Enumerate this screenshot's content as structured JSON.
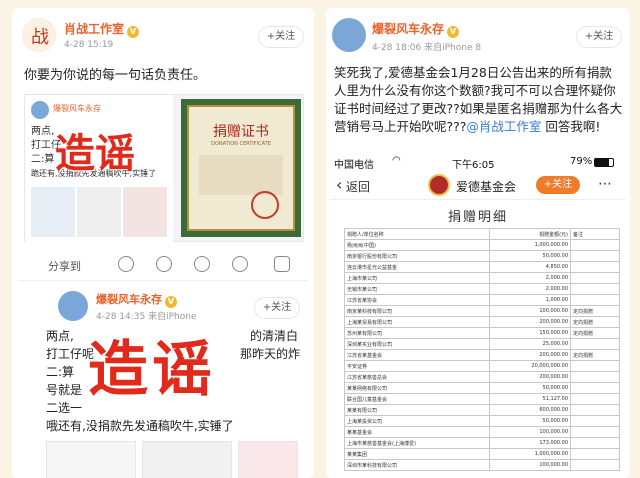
{
  "left_post": {
    "author": "肖战工作室",
    "time": "4-28 15:19",
    "follow_label": "+关注",
    "text": "你要为你说的每一句话负责任。",
    "embedded_screenshot": {
      "author": "爆裂风车永存",
      "stamp": "造谣",
      "certificate_title": "捐赠证书",
      "certificate_subtitle": "DONATION CERTIFICATE",
      "text_lines": [
        "两点,",
        "打工仔",
        "二:算",
        "跪还有,没捐款先发通稿吹牛,实锤了"
      ]
    },
    "actions": {
      "share": "分享到"
    }
  },
  "left_repost": {
    "author": "爆裂风车永存",
    "time": "4-28 14:35",
    "source": "来自iPhone",
    "follow_label": "+关注",
    "stamp": "造谣",
    "text_lines": [
      "两点,",
      "打工仔呢",
      "二:算",
      "号就是",
      "二选一",
      "哦还有,没捐款先发通稿吹牛,实锤了"
    ],
    "text_right": [
      "的清清白",
      "那昨天的炸"
    ]
  },
  "right_post": {
    "author": "爆裂风车永存",
    "time": "4-28 18:06",
    "source": "来自iPhone 8",
    "follow_label": "+关注",
    "text": "笑死我了,爱德基金会1月28日公告出来的所有捐款人里为什么没有你这个数额?我可不可以合理怀疑你证书时间经过了更改??如果是匿名捐赠那为什么各大营销号马上开始吹呢???",
    "mention": "@肖战工作室",
    "text_tail": "回答我啊!",
    "phone": {
      "carrier": "中国电信",
      "clock": "下午6:05",
      "battery": "79%",
      "back_label": "返回",
      "org_name": "爱德基金会",
      "follow_label": "+关注",
      "page_heading": "捐赠明细",
      "table_header": [
        "捐赠人/单位名称",
        "捐赠金额(元)",
        "备注"
      ],
      "rows": [
        [
          "杨洲洲(中国)",
          "1,000,000.00",
          ""
        ],
        [
          "南京银行股份有限公司",
          "50,000.00",
          ""
        ],
        [
          "连云港市星光公益基金",
          "4,850.00",
          ""
        ],
        [
          "上海市某公司",
          "2,000.00",
          ""
        ],
        [
          "无锡市某公司",
          "2,000.00",
          ""
        ],
        [
          "江苏省某协会",
          "1,000.00",
          ""
        ],
        [
          "南京某科技有限公司",
          "100,000.00",
          "定向捐赠"
        ],
        [
          "上海某贸易有限公司",
          "200,000.00",
          "定向捐赠"
        ],
        [
          "苏州某有限公司",
          "150,000.00",
          "定向捐赠"
        ],
        [
          "深圳某实业有限公司",
          "25,000.00",
          ""
        ],
        [
          "江苏省某基金会",
          "200,000.00",
          "定向捐赠"
        ],
        [
          "平安证券",
          "20,000,000.00",
          ""
        ],
        [
          "江苏省某慈善总会",
          "200,000.00",
          ""
        ],
        [
          "某某网络有限公司",
          "50,000.00",
          ""
        ],
        [
          "联合国儿童基金会",
          "51,127.00",
          ""
        ],
        [
          "某某有限公司",
          "600,000.00",
          ""
        ],
        [
          "上海某投资公司",
          "50,000.00",
          ""
        ],
        [
          "某某基金会",
          "100,000.00",
          ""
        ],
        [
          "上海市某慈善基金会(上海博爱)",
          "173,000.00",
          ""
        ],
        [
          "某某集团",
          "1,000,000.00",
          ""
        ],
        [
          "深圳市某科技有限公司",
          "100,000.00",
          ""
        ]
      ]
    }
  }
}
